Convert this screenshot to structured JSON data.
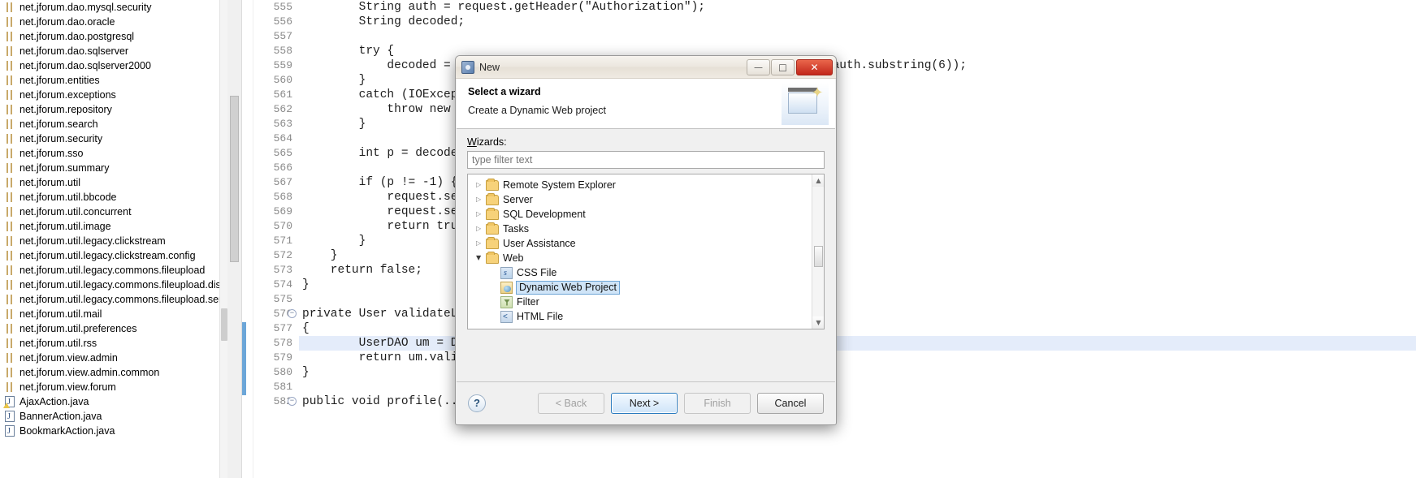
{
  "explorer": {
    "items": [
      {
        "label": "net.jforum.dao.mysql.security",
        "icon": "package-icon"
      },
      {
        "label": "net.jforum.dao.oracle",
        "icon": "package-icon"
      },
      {
        "label": "net.jforum.dao.postgresql",
        "icon": "package-icon"
      },
      {
        "label": "net.jforum.dao.sqlserver",
        "icon": "package-icon"
      },
      {
        "label": "net.jforum.dao.sqlserver2000",
        "icon": "package-icon"
      },
      {
        "label": "net.jforum.entities",
        "icon": "package-icon"
      },
      {
        "label": "net.jforum.exceptions",
        "icon": "package-icon"
      },
      {
        "label": "net.jforum.repository",
        "icon": "package-icon"
      },
      {
        "label": "net.jforum.search",
        "icon": "package-icon"
      },
      {
        "label": "net.jforum.security",
        "icon": "package-icon"
      },
      {
        "label": "net.jforum.sso",
        "icon": "package-icon"
      },
      {
        "label": "net.jforum.summary",
        "icon": "package-icon"
      },
      {
        "label": "net.jforum.util",
        "icon": "package-icon"
      },
      {
        "label": "net.jforum.util.bbcode",
        "icon": "package-icon"
      },
      {
        "label": "net.jforum.util.concurrent",
        "icon": "package-icon"
      },
      {
        "label": "net.jforum.util.image",
        "icon": "package-icon"
      },
      {
        "label": "net.jforum.util.legacy.clickstream",
        "icon": "package-icon"
      },
      {
        "label": "net.jforum.util.legacy.clickstream.config",
        "icon": "package-icon"
      },
      {
        "label": "net.jforum.util.legacy.commons.fileupload",
        "icon": "package-icon"
      },
      {
        "label": "net.jforum.util.legacy.commons.fileupload.disk",
        "icon": "package-icon"
      },
      {
        "label": "net.jforum.util.legacy.commons.fileupload.servlet",
        "icon": "package-icon"
      },
      {
        "label": "net.jforum.util.mail",
        "icon": "package-icon"
      },
      {
        "label": "net.jforum.util.preferences",
        "icon": "package-icon"
      },
      {
        "label": "net.jforum.util.rss",
        "icon": "package-icon"
      },
      {
        "label": "net.jforum.view.admin",
        "icon": "package-icon"
      },
      {
        "label": "net.jforum.view.admin.common",
        "icon": "package-icon"
      },
      {
        "label": "net.jforum.view.forum",
        "icon": "package-icon"
      },
      {
        "label": "AjaxAction.java",
        "icon": "java-file-warning-icon"
      },
      {
        "label": "BannerAction.java",
        "icon": "java-file-icon"
      },
      {
        "label": "BookmarkAction.java",
        "icon": "java-file-icon"
      }
    ]
  },
  "editor": {
    "first_line_number": 555,
    "lines": [
      {
        "n": "555",
        "code": "        String auth = request.getHeader(\"Authorization\");"
      },
      {
        "n": "556",
        "code": "        String decoded;"
      },
      {
        "n": "557",
        "code": ""
      },
      {
        "n": "558",
        "code": "        try {"
      },
      {
        "n": "559",
        "code": "            decoded = new String(new sun.misc.BASE64Decoder().decodeBuffer(auth.substring(6));"
      },
      {
        "n": "560",
        "code": "        }"
      },
      {
        "n": "561",
        "code": "        catch (IOException e) {"
      },
      {
        "n": "562",
        "code": "            throw new ForumException(e);"
      },
      {
        "n": "563",
        "code": "        }"
      },
      {
        "n": "564",
        "code": ""
      },
      {
        "n": "565",
        "code": "        int p = decoded.indexOf(':');"
      },
      {
        "n": "566",
        "code": ""
      },
      {
        "n": "567",
        "code": "        if (p != -1) {"
      },
      {
        "n": "568",
        "code": "            request.setAttribute(\"username\", decoded.substring(0, p));"
      },
      {
        "n": "569",
        "code": "            request.setAttribute(\"password\", decoded.substring(p + 1));"
      },
      {
        "n": "570",
        "code": "            return true;"
      },
      {
        "n": "571",
        "code": "        }"
      },
      {
        "n": "572",
        "code": "    }"
      },
      {
        "n": "573",
        "code": "    return false;"
      },
      {
        "n": "574",
        "code": "}"
      },
      {
        "n": "575",
        "code": ""
      },
      {
        "n": "576",
        "code": "private User validateLogin(...)",
        "fold": true
      },
      {
        "n": "577",
        "code": "{"
      },
      {
        "n": "578",
        "code": "        UserDAO um = DataAccessDriver.getInstance().newUserDAO();",
        "highlight": true
      },
      {
        "n": "579",
        "code": "        return um.validateLogin(username, password);"
      },
      {
        "n": "580",
        "code": "}"
      },
      {
        "n": "581",
        "code": ""
      },
      {
        "n": "582",
        "code": "public void profile(...)",
        "fold": true
      }
    ]
  },
  "dialog": {
    "title": "New",
    "window_controls": {
      "minimize": "—",
      "maximize": "□",
      "close": "✕"
    },
    "header": {
      "title": "Select a wizard",
      "subtitle": "Create a Dynamic Web project"
    },
    "wizards_label": "Wizards:",
    "filter_placeholder": "type filter text",
    "filter_value": "",
    "tree": [
      {
        "label": "Remote System Explorer",
        "type": "folder",
        "expanded": false,
        "level": 0
      },
      {
        "label": "Server",
        "type": "folder",
        "expanded": false,
        "level": 0
      },
      {
        "label": "SQL Development",
        "type": "folder",
        "expanded": false,
        "level": 0
      },
      {
        "label": "Tasks",
        "type": "folder",
        "expanded": false,
        "level": 0
      },
      {
        "label": "User Assistance",
        "type": "folder",
        "expanded": false,
        "level": 0
      },
      {
        "label": "Web",
        "type": "folder",
        "expanded": true,
        "level": 0
      },
      {
        "label": "CSS File",
        "type": "css",
        "level": 1
      },
      {
        "label": "Dynamic Web Project",
        "type": "proj",
        "level": 1,
        "selected": true
      },
      {
        "label": "Filter",
        "type": "filter",
        "level": 1
      },
      {
        "label": "HTML File",
        "type": "html",
        "level": 1
      }
    ],
    "scrollbar": {
      "up": "▲",
      "down": "▼"
    },
    "footer": {
      "help": "?",
      "back": "< Back",
      "next": "Next >",
      "finish": "Finish",
      "cancel": "Cancel"
    }
  },
  "colors": {
    "selection_blue": "#cfe4f7",
    "close_red": "#c2271b",
    "folder_yellow": "#f7d27a",
    "keyword_purple": "#7f0055",
    "highlight_row": "#e4ecfa"
  }
}
